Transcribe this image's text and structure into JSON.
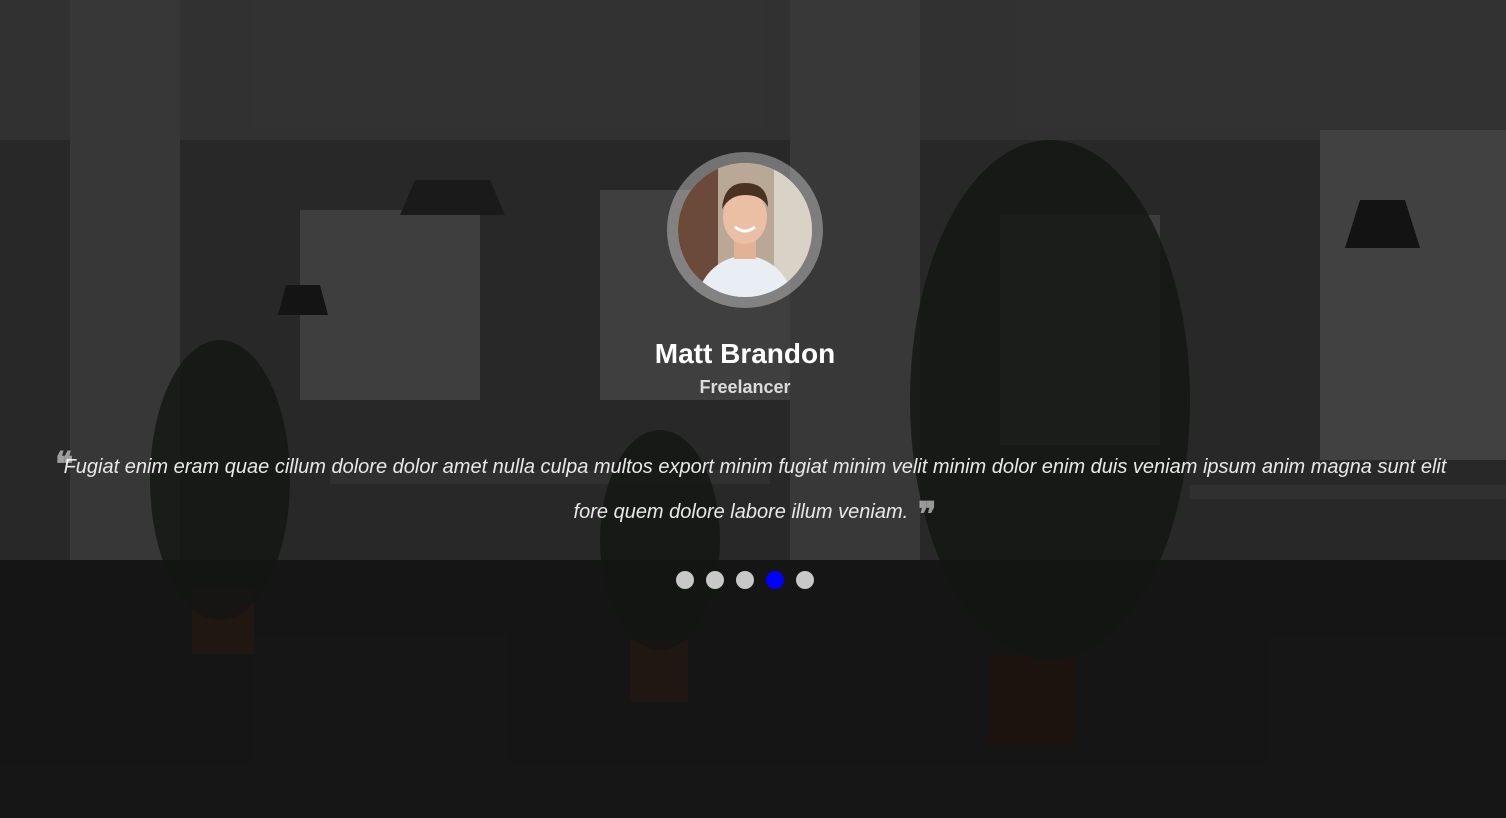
{
  "testimonial": {
    "name": "Matt Brandon",
    "role": "Freelancer",
    "quote": "Fugiat enim eram quae cillum dolore dolor amet nulla culpa multos export minim fugiat minim velit minim dolor enim duis veniam ipsum anim magna sunt elit fore quem dolore labore illum veniam.",
    "quote_open_icon": "quote-left-icon",
    "quote_close_icon": "quote-right-icon"
  },
  "pagination": {
    "count": 5,
    "active_index": 3
  },
  "colors": {
    "active_dot": "#0000ff",
    "inactive_dot": "#c8c8c8",
    "name_text": "#ffffff"
  }
}
